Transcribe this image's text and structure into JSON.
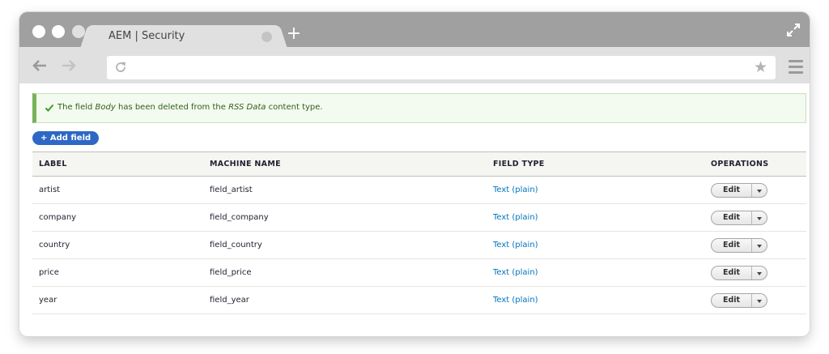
{
  "browser": {
    "tab_title": "AEM | Security",
    "new_tab_symbol": "+",
    "address_value": "",
    "icons": [
      "back-icon",
      "forward-icon",
      "reload-icon",
      "star-icon",
      "menu-icon",
      "fullscreen-icon",
      "plus-icon"
    ]
  },
  "status": {
    "prefix": "The field ",
    "field_name": "Body",
    "middle": " has been deleted from the ",
    "content_type": "RSS Data",
    "suffix": " content type.",
    "color": "#77b259"
  },
  "actions": {
    "add_field": "+ Add field",
    "accent": "#2d68c4"
  },
  "table": {
    "headers": {
      "label": "LABEL",
      "machine_name": "MACHINE NAME",
      "field_type": "FIELD TYPE",
      "operations": "OPERATIONS"
    },
    "rows": [
      {
        "label": "artist",
        "machine_name": "field_artist",
        "field_type": "Text (plain)",
        "edit": "Edit"
      },
      {
        "label": "company",
        "machine_name": "field_company",
        "field_type": "Text (plain)",
        "edit": "Edit"
      },
      {
        "label": "country",
        "machine_name": "field_country",
        "field_type": "Text (plain)",
        "edit": "Edit"
      },
      {
        "label": "price",
        "machine_name": "field_price",
        "field_type": "Text (plain)",
        "edit": "Edit"
      },
      {
        "label": "year",
        "machine_name": "field_year",
        "field_type": "Text (plain)",
        "edit": "Edit"
      }
    ]
  }
}
